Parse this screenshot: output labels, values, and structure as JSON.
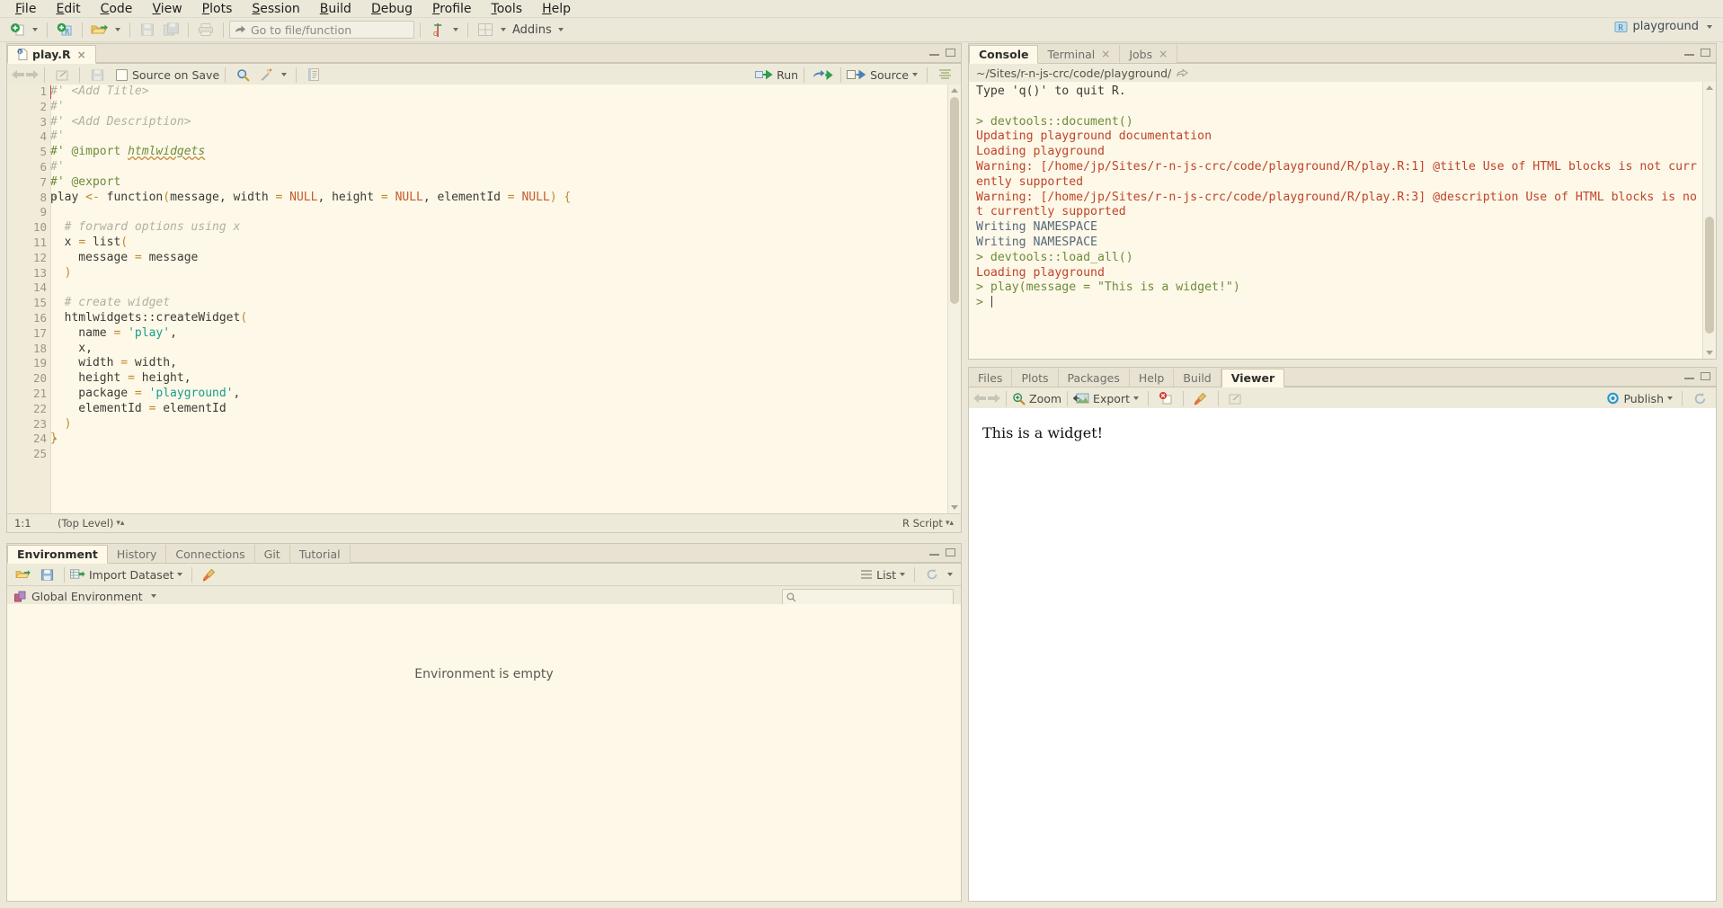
{
  "menubar": {
    "items": [
      {
        "label": "File",
        "accel": "F"
      },
      {
        "label": "Edit",
        "accel": "E"
      },
      {
        "label": "Code",
        "accel": "C"
      },
      {
        "label": "View",
        "accel": "V"
      },
      {
        "label": "Plots",
        "accel": "P"
      },
      {
        "label": "Session",
        "accel": "S"
      },
      {
        "label": "Build",
        "accel": "B"
      },
      {
        "label": "Debug",
        "accel": "D"
      },
      {
        "label": "Profile",
        "accel": "P"
      },
      {
        "label": "Tools",
        "accel": "T"
      },
      {
        "label": "Help",
        "accel": "H"
      }
    ]
  },
  "toolbar": {
    "new_file_icon": "new-file-icon",
    "new_project_icon": "new-project-icon",
    "open_file_icon": "open-file-icon",
    "save_icon": "save-icon",
    "save_all_icon": "save-all-icon",
    "print_icon": "print-icon",
    "goto_placeholder": "Go to file/function",
    "goto_icon": "goto-arrow-icon",
    "version_control_icon": "version-control-icon",
    "workspace_panes_icon": "workspace-panes-icon",
    "addins_label": "Addins",
    "project_name": "playground",
    "project_icon": "r-project-icon"
  },
  "source": {
    "tab_label": "play.R",
    "tab_icon": "r-script-icon",
    "tab_close": "×",
    "toolbar": {
      "back_icon": "back-arrow-icon",
      "forward_icon": "forward-arrow-icon",
      "popout_icon": "show-in-new-window-icon",
      "save_icon": "save-icon",
      "source_on_save_label": "Source on Save",
      "find_icon": "find-icon",
      "magic_icon": "code-tools-icon",
      "compile_report_icon": "compile-report-icon",
      "run_label": "Run",
      "rerun_icon": "rerun-icon",
      "source_label": "Source",
      "outline_icon": "document-outline-icon"
    },
    "lines": [
      {
        "n": "1",
        "fold": "",
        "tokens": [
          {
            "t": "#' <Add Title>",
            "c": "c-cmt"
          }
        ]
      },
      {
        "n": "2",
        "fold": "",
        "tokens": [
          {
            "t": "#'",
            "c": "c-cmt"
          }
        ]
      },
      {
        "n": "3",
        "fold": "",
        "tokens": [
          {
            "t": "#' <Add Description>",
            "c": "c-cmt"
          }
        ]
      },
      {
        "n": "4",
        "fold": "",
        "tokens": [
          {
            "t": "#'",
            "c": "c-cmt"
          }
        ]
      },
      {
        "n": "5",
        "fold": "",
        "tokens": [
          {
            "t": "#' ",
            "c": "c-rox"
          },
          {
            "t": "@import ",
            "c": "c-roxat"
          },
          {
            "t": "htmlwidgets",
            "c": "c-rox c-uline"
          }
        ]
      },
      {
        "n": "6",
        "fold": "",
        "tokens": [
          {
            "t": "#'",
            "c": "c-cmt"
          }
        ]
      },
      {
        "n": "7",
        "fold": "",
        "tokens": [
          {
            "t": "#' ",
            "c": "c-rox"
          },
          {
            "t": "@export",
            "c": "c-roxat"
          }
        ]
      },
      {
        "n": "8",
        "fold": "▾",
        "tokens": [
          {
            "t": "play ",
            "c": "c-plain"
          },
          {
            "t": "<-",
            "c": "c-op"
          },
          {
            "t": " function",
            "c": "c-plain"
          },
          {
            "t": "(",
            "c": "c-par"
          },
          {
            "t": "message, width ",
            "c": "c-plain"
          },
          {
            "t": "=",
            "c": "c-op"
          },
          {
            "t": " ",
            "c": "c-plain"
          },
          {
            "t": "NULL",
            "c": "c-num"
          },
          {
            "t": ", height ",
            "c": "c-plain"
          },
          {
            "t": "=",
            "c": "c-op"
          },
          {
            "t": " ",
            "c": "c-plain"
          },
          {
            "t": "NULL",
            "c": "c-num"
          },
          {
            "t": ", elementId ",
            "c": "c-plain"
          },
          {
            "t": "=",
            "c": "c-op"
          },
          {
            "t": " ",
            "c": "c-plain"
          },
          {
            "t": "NULL",
            "c": "c-num"
          },
          {
            "t": ")",
            "c": "c-par"
          },
          {
            "t": " ",
            "c": "c-plain"
          },
          {
            "t": "{",
            "c": "c-par"
          }
        ]
      },
      {
        "n": "9",
        "fold": "",
        "tokens": [
          {
            "t": "",
            "c": "c-plain"
          }
        ]
      },
      {
        "n": "10",
        "fold": "",
        "tokens": [
          {
            "t": "  # forward options using x",
            "c": "c-cmt"
          }
        ]
      },
      {
        "n": "11",
        "fold": "",
        "tokens": [
          {
            "t": "  x ",
            "c": "c-plain"
          },
          {
            "t": "=",
            "c": "c-op"
          },
          {
            "t": " list",
            "c": "c-plain"
          },
          {
            "t": "(",
            "c": "c-par"
          }
        ]
      },
      {
        "n": "12",
        "fold": "",
        "tokens": [
          {
            "t": "    message ",
            "c": "c-plain"
          },
          {
            "t": "=",
            "c": "c-op"
          },
          {
            "t": " message",
            "c": "c-plain"
          }
        ]
      },
      {
        "n": "13",
        "fold": "",
        "tokens": [
          {
            "t": "  ",
            "c": "c-plain"
          },
          {
            "t": ")",
            "c": "c-par"
          }
        ]
      },
      {
        "n": "14",
        "fold": "",
        "tokens": [
          {
            "t": "",
            "c": "c-plain"
          }
        ]
      },
      {
        "n": "15",
        "fold": "",
        "tokens": [
          {
            "t": "  # create widget",
            "c": "c-cmt"
          }
        ]
      },
      {
        "n": "16",
        "fold": "",
        "tokens": [
          {
            "t": "  htmlwidgets::createWidget",
            "c": "c-plain"
          },
          {
            "t": "(",
            "c": "c-par"
          }
        ]
      },
      {
        "n": "17",
        "fold": "",
        "tokens": [
          {
            "t": "    name ",
            "c": "c-plain"
          },
          {
            "t": "=",
            "c": "c-op"
          },
          {
            "t": " ",
            "c": "c-plain"
          },
          {
            "t": "'play'",
            "c": "c-str"
          },
          {
            "t": ",",
            "c": "c-plain"
          }
        ]
      },
      {
        "n": "18",
        "fold": "",
        "tokens": [
          {
            "t": "    x,",
            "c": "c-plain"
          }
        ]
      },
      {
        "n": "19",
        "fold": "",
        "tokens": [
          {
            "t": "    width ",
            "c": "c-plain"
          },
          {
            "t": "=",
            "c": "c-op"
          },
          {
            "t": " width,",
            "c": "c-plain"
          }
        ]
      },
      {
        "n": "20",
        "fold": "",
        "tokens": [
          {
            "t": "    height ",
            "c": "c-plain"
          },
          {
            "t": "=",
            "c": "c-op"
          },
          {
            "t": " height,",
            "c": "c-plain"
          }
        ]
      },
      {
        "n": "21",
        "fold": "",
        "tokens": [
          {
            "t": "    package ",
            "c": "c-plain"
          },
          {
            "t": "=",
            "c": "c-op"
          },
          {
            "t": " ",
            "c": "c-plain"
          },
          {
            "t": "'playground'",
            "c": "c-str"
          },
          {
            "t": ",",
            "c": "c-plain"
          }
        ]
      },
      {
        "n": "22",
        "fold": "",
        "tokens": [
          {
            "t": "    elementId ",
            "c": "c-plain"
          },
          {
            "t": "=",
            "c": "c-op"
          },
          {
            "t": " elementId",
            "c": "c-plain"
          }
        ]
      },
      {
        "n": "23",
        "fold": "",
        "tokens": [
          {
            "t": "  ",
            "c": "c-plain"
          },
          {
            "t": ")",
            "c": "c-par"
          }
        ]
      },
      {
        "n": "24",
        "fold": "▴",
        "tokens": [
          {
            "t": "}",
            "c": "c-par"
          }
        ]
      },
      {
        "n": "25",
        "fold": "",
        "tokens": [
          {
            "t": "",
            "c": "c-plain"
          }
        ]
      }
    ],
    "status": {
      "cursor": "1:1",
      "scope": "(Top Level)",
      "filetype": "R Script"
    }
  },
  "console": {
    "tabs": [
      {
        "label": "Console",
        "active": true,
        "closable": false
      },
      {
        "label": "Terminal",
        "active": false,
        "closable": true
      },
      {
        "label": "Jobs",
        "active": false,
        "closable": true
      }
    ],
    "path": "~/Sites/r-n-js-crc/code/playground/",
    "path_icon": "open-in-finder-icon",
    "lines": [
      {
        "text": "Type 'q()' to quit R.",
        "c": "o-grey"
      },
      {
        "text": "",
        "c": "o-grey"
      },
      {
        "text": "> devtools::document()",
        "c": "o-green"
      },
      {
        "text": "Updating playground documentation",
        "c": "o-red"
      },
      {
        "text": "Loading playground",
        "c": "o-red"
      },
      {
        "text": "Warning: [/home/jp/Sites/r-n-js-crc/code/playground/R/play.R:1] @title Use of HTML blocks is not curr",
        "c": "o-red"
      },
      {
        "text": "ently supported",
        "c": "o-red"
      },
      {
        "text": "Warning: [/home/jp/Sites/r-n-js-crc/code/playground/R/play.R:3] @description Use of HTML blocks is no",
        "c": "o-red"
      },
      {
        "text": "t currently supported",
        "c": "o-red"
      },
      {
        "text": "Writing NAMESPACE",
        "c": "o-blue"
      },
      {
        "text": "Writing NAMESPACE",
        "c": "o-blue"
      },
      {
        "text": "> devtools::load_all()",
        "c": "o-green"
      },
      {
        "text": "Loading playground",
        "c": "o-red"
      },
      {
        "text": "> play(message = \"This is a widget!\")",
        "c": "o-green"
      },
      {
        "text": ">",
        "c": "o-green",
        "caret": true
      }
    ]
  },
  "environment": {
    "tabs": [
      {
        "label": "Environment",
        "active": true
      },
      {
        "label": "History",
        "active": false
      },
      {
        "label": "Connections",
        "active": false
      },
      {
        "label": "Git",
        "active": false
      },
      {
        "label": "Tutorial",
        "active": false
      }
    ],
    "toolbar": {
      "load_icon": "load-workspace-icon",
      "save_icon": "save-workspace-icon",
      "import_label": "Import Dataset",
      "import_icon": "import-dataset-icon",
      "broom_icon": "clear-objects-icon",
      "list_label": "List",
      "list_icon": "list-view-icon",
      "refresh_icon": "refresh-icon"
    },
    "scope_label": "Global Environment",
    "scope_icon": "environment-icon",
    "search_icon": "search-icon",
    "search_value": "",
    "empty_message": "Environment is empty"
  },
  "viewer": {
    "tabs": [
      {
        "label": "Files",
        "active": false
      },
      {
        "label": "Plots",
        "active": false
      },
      {
        "label": "Packages",
        "active": false
      },
      {
        "label": "Help",
        "active": false
      },
      {
        "label": "Build",
        "active": false
      },
      {
        "label": "Viewer",
        "active": true
      }
    ],
    "toolbar": {
      "back_icon": "back-arrow-icon",
      "forward_icon": "forward-arrow-icon",
      "zoom_label": "Zoom",
      "zoom_icon": "zoom-icon",
      "export_label": "Export",
      "export_icon": "export-icon",
      "remove_icon": "remove-plot-icon",
      "clear_icon": "clear-all-icon",
      "popout_icon": "show-in-new-window-icon",
      "publish_label": "Publish",
      "publish_icon": "publish-icon",
      "refresh_icon": "refresh-icon"
    },
    "content": "This is a widget!"
  },
  "colors": {
    "chrome": "#ece8d9",
    "pane_bg": "#fdf8e8",
    "tab_inactive": "#e7e2d2",
    "border": "#ccc6b3",
    "console_green": "#6f8c3a",
    "console_red": "#c0442a",
    "console_blue": "#56687a",
    "string_teal": "#1a9c8e",
    "number_orange": "#c45b2e",
    "operator_gold": "#c08a2a",
    "comment_grey": "#b2b0a3",
    "roxygen_green": "#6f8c3a",
    "publish_blue": "#2196d4"
  }
}
